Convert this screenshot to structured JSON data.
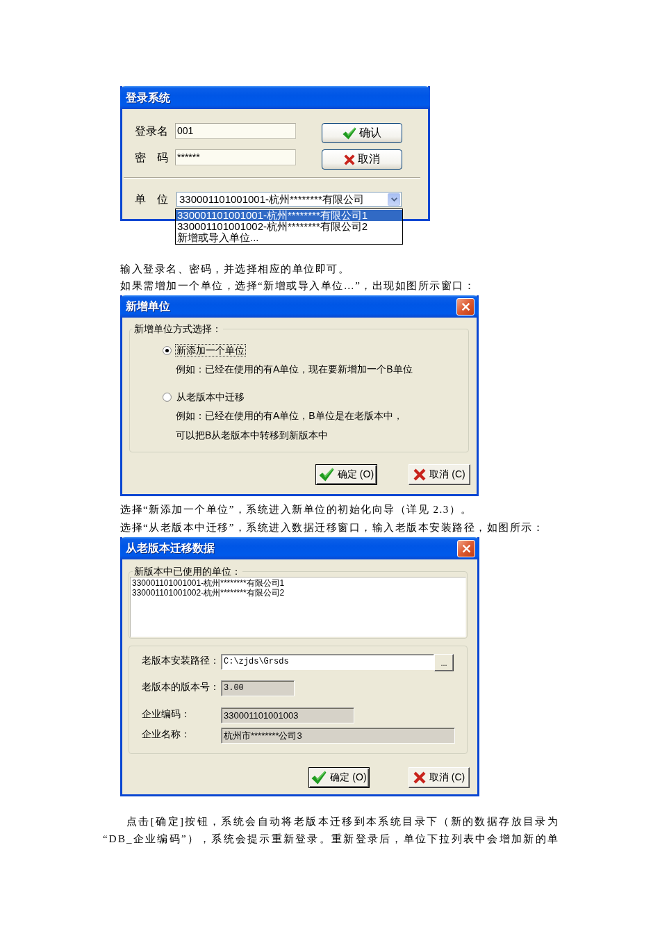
{
  "login_dialog": {
    "title": "登录系统",
    "fields": [
      {
        "label": "登录名",
        "value": "001"
      },
      {
        "label": "密　码",
        "value": "******"
      }
    ],
    "buttons": [
      {
        "kind": "ok",
        "label": "确认"
      },
      {
        "kind": "cancel",
        "label": "取消"
      }
    ],
    "unit": {
      "label": "单　位",
      "value": "330001101001001-杭州********有限公司",
      "expanded": true,
      "options": [
        {
          "label": "330001101001001-杭州********有限公司1",
          "selected": true
        },
        {
          "label": "330001101001002-杭州********有限公司2",
          "selected": false
        },
        {
          "label": "新增或导入单位...",
          "selected": false
        }
      ]
    }
  },
  "intro_lines": [
    "输入登录名、密码，并选择相应的单位即可。",
    "如果需增加一个单位，选择“新增或导入单位…”，出现如图所示窗口："
  ],
  "new_unit_dialog": {
    "title": "新增单位",
    "closable": true,
    "group_title": "新增单位方式选择：",
    "options": [
      {
        "label": "新添加一个单位",
        "selected": true,
        "notes": [
          "例如：已经在使用的有A单位，现在要新增加一个B单位"
        ]
      },
      {
        "label": "从老版本中迁移",
        "selected": false,
        "notes": [
          "例如：已经在使用的有A单位，B单位是在老版本中，",
          "可以把B从老版本中转移到新版本中"
        ]
      }
    ],
    "buttons": [
      {
        "kind": "ok",
        "label": "确定 (O)"
      },
      {
        "kind": "cancel",
        "label": "取消 (C)"
      }
    ]
  },
  "choice_lines": [
    "选择“新添加一个单位”，系统进入新单位的初始化向导（详见 2.3）。",
    "选择“从老版本中迁移”，系统进入数据迁移窗口，输入老版本安装路径，如图所示："
  ],
  "migrate_dialog": {
    "title": "从老版本迁移数据",
    "closable": true,
    "used_units": {
      "title": "新版本中已使用的单位：",
      "items": [
        "330001101001001-杭州********有限公司1",
        "330001101001002-杭州********有限公司2"
      ]
    },
    "fields": [
      {
        "label": "老版本安装路径：",
        "value": "C:\\zjds\\Grsds",
        "disabled": false,
        "browse_button": "..."
      },
      {
        "label": "老版本的版本号：",
        "value": "3.00",
        "disabled": true
      },
      {
        "label": "企业编码：",
        "value": "330001101001003",
        "disabled": true
      },
      {
        "label": "企业名称：",
        "value": "杭州市********公司3",
        "disabled": true
      }
    ],
    "buttons": [
      {
        "kind": "ok",
        "label": "确定 (O)"
      },
      {
        "kind": "cancel",
        "label": "取消 (C)"
      }
    ]
  },
  "closing_paragraph": "点击[确定]按钮，系统会自动将老版本迁移到本系统目录下（新的数据存放目录为“DB_企业编码”），系统会提示重新登录。重新登录后，单位下拉列表中会增加新的单"
}
